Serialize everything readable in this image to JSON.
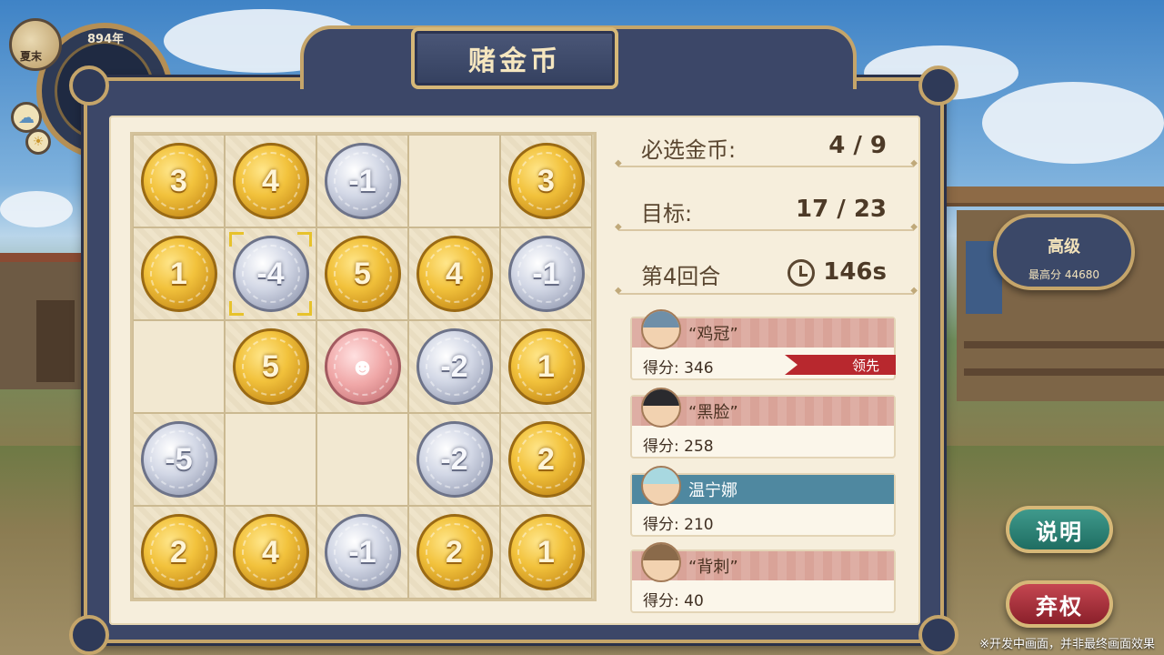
{
  "calendar": {
    "season": "夏末",
    "year": "894年"
  },
  "title": "赌金币",
  "grid": [
    [
      {
        "kind": "gold",
        "label": "3"
      },
      {
        "kind": "gold",
        "label": "4"
      },
      {
        "kind": "silver",
        "label": "-1"
      },
      {
        "kind": "empty",
        "label": ""
      },
      {
        "kind": "gold",
        "label": "3"
      }
    ],
    [
      {
        "kind": "gold",
        "label": "1"
      },
      {
        "kind": "silver",
        "label": "-4",
        "selected": true
      },
      {
        "kind": "gold",
        "label": "5"
      },
      {
        "kind": "gold",
        "label": "4"
      },
      {
        "kind": "silver",
        "label": "-1"
      }
    ],
    [
      {
        "kind": "empty",
        "label": ""
      },
      {
        "kind": "gold",
        "label": "5"
      },
      {
        "kind": "pink",
        "label": "☻"
      },
      {
        "kind": "silver",
        "label": "-2"
      },
      {
        "kind": "gold",
        "label": "1"
      }
    ],
    [
      {
        "kind": "silver",
        "label": "-5"
      },
      {
        "kind": "empty",
        "label": ""
      },
      {
        "kind": "empty",
        "label": ""
      },
      {
        "kind": "silver",
        "label": "-2"
      },
      {
        "kind": "gold",
        "label": "2"
      }
    ],
    [
      {
        "kind": "gold",
        "label": "2"
      },
      {
        "kind": "gold",
        "label": "4"
      },
      {
        "kind": "silver",
        "label": "-1"
      },
      {
        "kind": "gold",
        "label": "2"
      },
      {
        "kind": "gold",
        "label": "1"
      }
    ]
  ],
  "info": {
    "required_label": "必选金币:",
    "required_value": "4 / 9",
    "target_label": "目标:",
    "target_value": "17 / 23",
    "round_label": "第4回合",
    "timer_value": "146s"
  },
  "players": [
    {
      "name": "“鸡冠”",
      "score_label": "得分:",
      "score": "346",
      "lead_label": "领先",
      "hair": "#6f8fa8"
    },
    {
      "name": "“黑脸”",
      "score_label": "得分:",
      "score": "258",
      "hair": "#2a2a2e"
    },
    {
      "name": "温宁娜",
      "score_label": "得分:",
      "score": "210",
      "me": true,
      "hair": "#a8d8e0"
    },
    {
      "name": "“背刺”",
      "score_label": "得分:",
      "score": "40",
      "hair": "#8a6a4a"
    }
  ],
  "level": {
    "title": "高级",
    "best": "最高分 44680"
  },
  "buttons": {
    "help": "说明",
    "quit": "弃权"
  },
  "disclaimer": "※开发中画面，并非最终画面效果"
}
